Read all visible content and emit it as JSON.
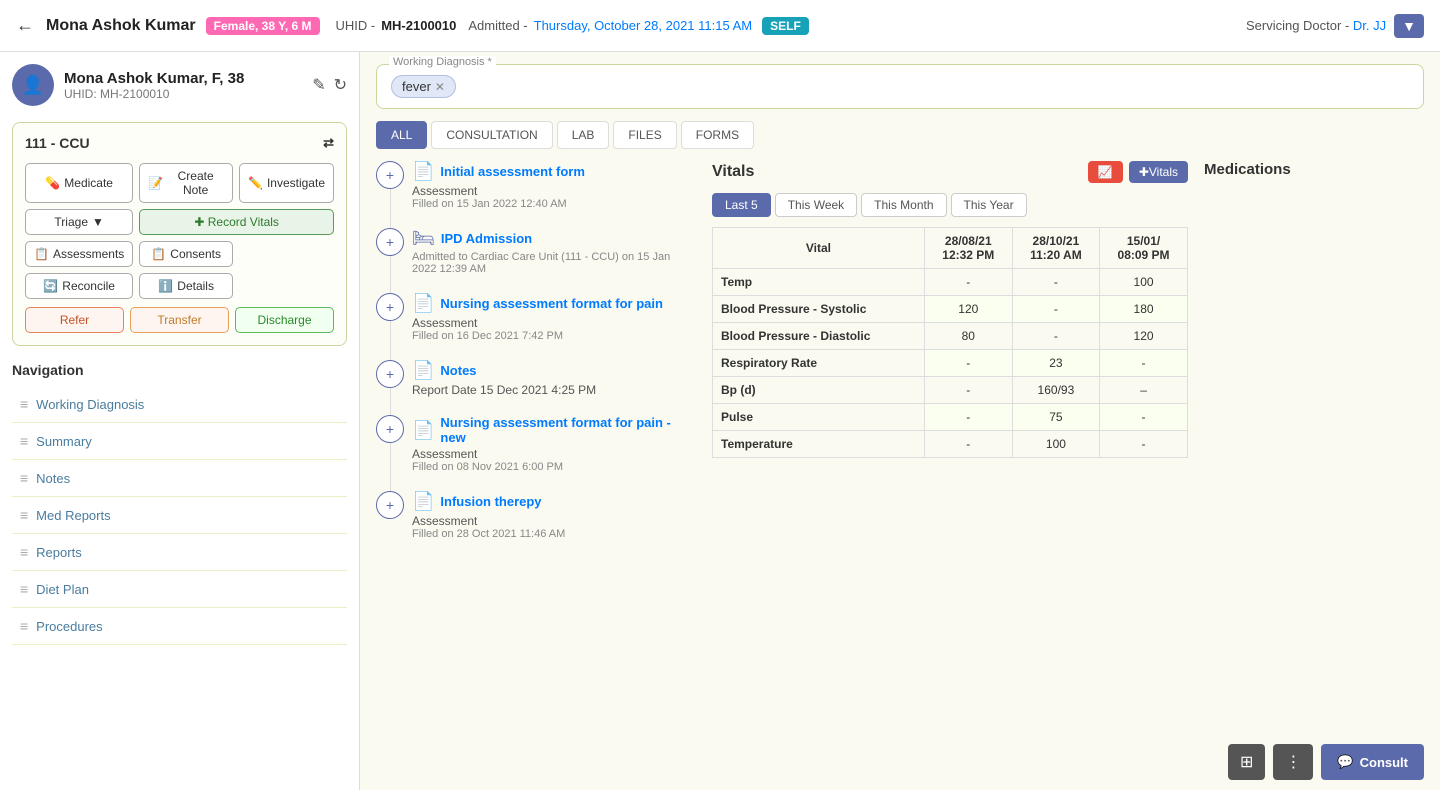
{
  "header": {
    "back_icon": "←",
    "patient_name": "Mona Ashok Kumar",
    "gender_badge": "Female, 38 Y, 6 M",
    "uhid_label": "UHID -",
    "uhid_value": "MH-2100010",
    "admitted_label": "Admitted -",
    "admitted_date": "Thursday, October 28, 2021 11:15 AM",
    "self_badge": "SELF",
    "servicing_label": "Servicing Doctor -",
    "doctor_name": "Dr. JJ",
    "dropdown_icon": "▼"
  },
  "sidebar": {
    "patient_name": "Mona Ashok Kumar, F, 38",
    "uhid_label": "UHID:",
    "uhid_value": "MH-2100010",
    "edit_icon": "✎",
    "refresh_icon": "↻",
    "ccu_title": "111 - CCU",
    "transfer_icon": "⇄",
    "buttons": {
      "medicate": "Medicate",
      "create_note": "Create Note",
      "investigate": "Investigate",
      "triage": "Triage",
      "record_vitals": "✚ Record Vitals",
      "assessments": "Assessments",
      "consents": "Consents",
      "reconcile": "Reconcile",
      "details": "Details",
      "refer": "Refer",
      "transfer": "Transfer",
      "discharge": "Discharge"
    },
    "navigation_title": "Navigation",
    "nav_items": [
      {
        "id": "working-diagnosis",
        "label": "Working Diagnosis"
      },
      {
        "id": "summary",
        "label": "Summary"
      },
      {
        "id": "notes",
        "label": "Notes"
      },
      {
        "id": "med-reports",
        "label": "Med Reports"
      },
      {
        "id": "reports",
        "label": "Reports"
      },
      {
        "id": "diet-plan",
        "label": "Diet Plan"
      },
      {
        "id": "procedures",
        "label": "Procedures"
      }
    ]
  },
  "working_diagnosis": {
    "label": "Working Diagnosis *",
    "tag": "fever",
    "remove_icon": "✕"
  },
  "tabs": [
    {
      "id": "all",
      "label": "ALL",
      "active": true
    },
    {
      "id": "consultation",
      "label": "CONSULTATION",
      "active": false
    },
    {
      "id": "lab",
      "label": "LAB",
      "active": false
    },
    {
      "id": "files",
      "label": "FILES",
      "active": false
    },
    {
      "id": "forms",
      "label": "FORMS",
      "active": false
    }
  ],
  "feed": [
    {
      "id": "initial-assessment",
      "title": "Initial assessment form",
      "type": "Assessment",
      "date": "Filled on 15 Jan 2022 12:40 AM",
      "add_icon": "+",
      "doc_icon": "📄"
    },
    {
      "id": "ipd-admission",
      "title": "IPD Admission",
      "type": "",
      "date": "Admitted to Cardiac Care Unit (111 - CCU) on 15 Jan 2022 12:39 AM",
      "add_icon": "+",
      "doc_icon": "🛏"
    },
    {
      "id": "nursing-assessment-pain",
      "title": "Nursing assessment format for pain",
      "type": "Assessment",
      "date": "Filled on 16 Dec 2021 7:42 PM",
      "add_icon": "+",
      "doc_icon": "📄"
    },
    {
      "id": "notes",
      "title": "Notes",
      "type": "Report Date",
      "date": "15 Dec 2021 4:25 PM",
      "add_icon": "+",
      "doc_icon": "📄"
    },
    {
      "id": "nursing-assessment-new",
      "title": "Nursing assessment format for pain - new",
      "type": "Assessment",
      "date": "Filled on 08 Nov 2021 6:00 PM",
      "add_icon": "+",
      "doc_icon": "📄"
    },
    {
      "id": "infusion-therapy",
      "title": "Infusion therepy",
      "type": "Assessment",
      "date": "Filled on 28 Oct 2021 11:46 AM",
      "add_icon": "+",
      "doc_icon": "📄"
    }
  ],
  "vitals": {
    "title": "Vitals",
    "red_btn_icon": "📈",
    "vitals_btn_label": "✚Vitals",
    "period_tabs": [
      {
        "id": "last5",
        "label": "Last 5",
        "active": true
      },
      {
        "id": "this-week",
        "label": "This Week",
        "active": false
      },
      {
        "id": "this-month",
        "label": "This Month",
        "active": false
      },
      {
        "id": "this-year",
        "label": "This Year",
        "active": false
      }
    ],
    "columns": [
      {
        "date": "28/08/21",
        "time": "12:32 PM"
      },
      {
        "date": "28/10/21",
        "time": "11:20 AM"
      },
      {
        "date": "15/01/",
        "time": "08:09 PM"
      }
    ],
    "rows": [
      {
        "label": "Temp",
        "values": [
          "-",
          "-",
          "100"
        ]
      },
      {
        "label": "Blood Pressure - Systolic",
        "values": [
          "120",
          "-",
          "180"
        ]
      },
      {
        "label": "Blood Pressure - Diastolic",
        "values": [
          "80",
          "-",
          "120"
        ]
      },
      {
        "label": "Respiratory Rate",
        "values": [
          "-",
          "23",
          "-"
        ]
      },
      {
        "label": "Bp (d)",
        "values": [
          "-",
          "160/93",
          "–"
        ]
      },
      {
        "label": "Pulse",
        "values": [
          "-",
          "75",
          "-"
        ]
      },
      {
        "label": "Temperature",
        "values": [
          "-",
          "100",
          "-"
        ]
      }
    ]
  },
  "medications": {
    "title": "Medications"
  },
  "bottom_toolbar": {
    "grid_icon": "⊞",
    "more_icon": "⋮",
    "consult_icon": "💬",
    "consult_label": "Consult"
  }
}
